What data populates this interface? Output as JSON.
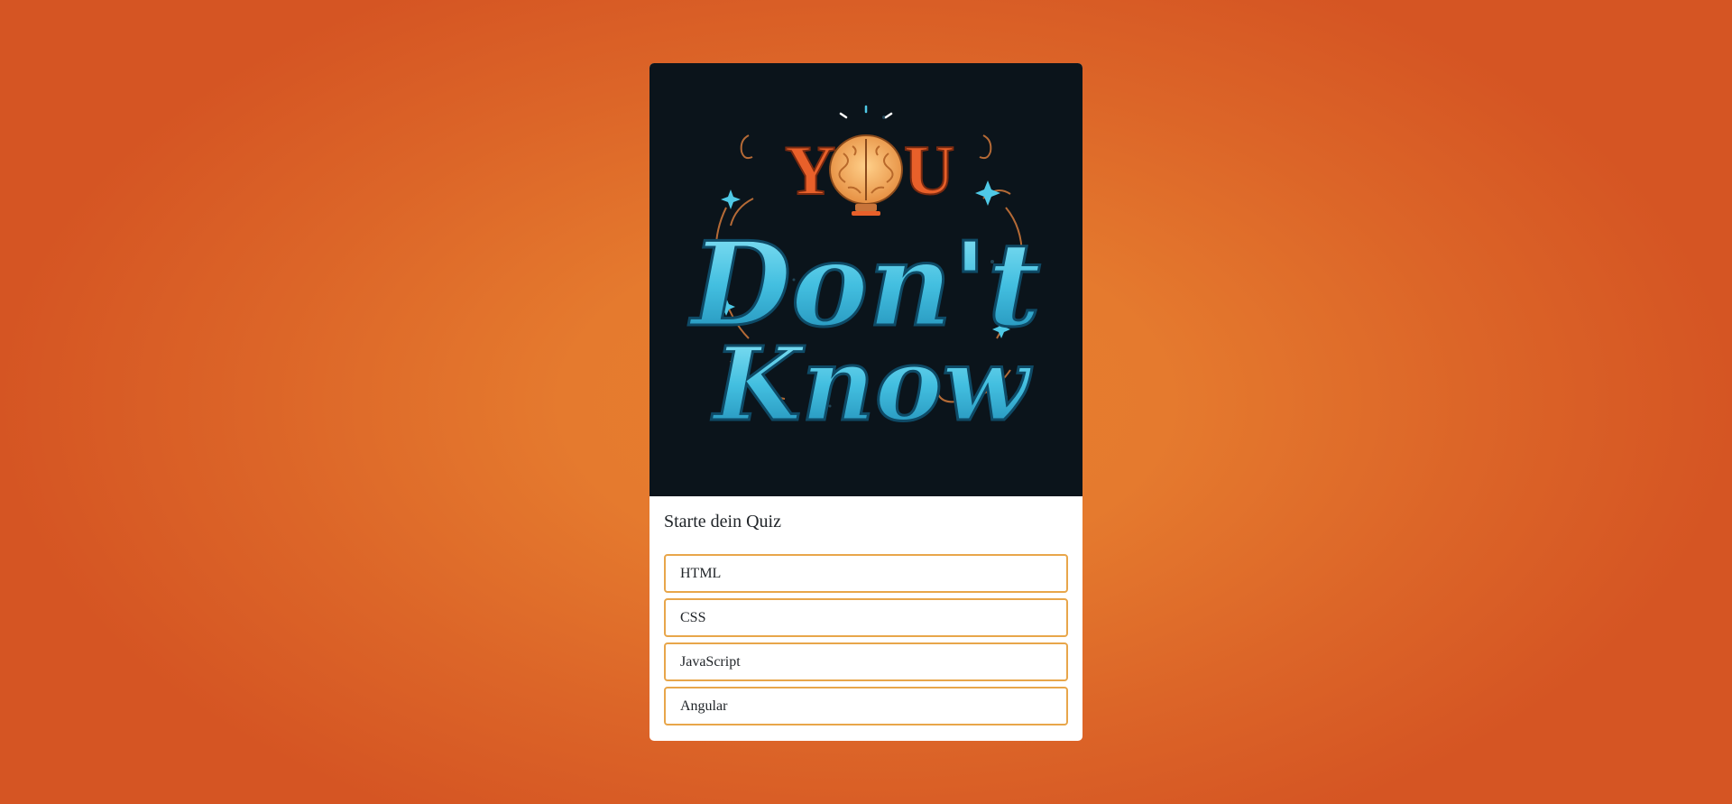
{
  "background": {
    "gradient_center": "#e77f2f",
    "gradient_edge": "#d55523"
  },
  "hero": {
    "image_name": "you-dont-know-logo",
    "logo_text": [
      "YOU",
      "Don't",
      "Know"
    ],
    "colors": {
      "background": "#0b141b",
      "cyan": "#4fc9e6",
      "orange": "#e8602a",
      "brain": "#f0a35a"
    }
  },
  "quiz": {
    "title": "Starte dein Quiz",
    "answers": [
      {
        "label": "HTML"
      },
      {
        "label": "CSS"
      },
      {
        "label": "JavaScript"
      },
      {
        "label": "Angular"
      }
    ]
  },
  "accent_color": "#e8a64a"
}
